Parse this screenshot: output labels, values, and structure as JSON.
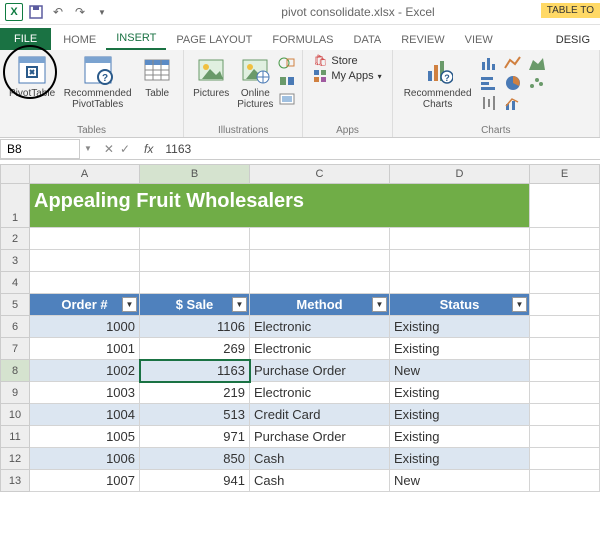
{
  "title": "pivot consolidate.xlsx - Excel",
  "table_tools": "TABLE TO",
  "tabs": {
    "file": "FILE",
    "home": "HOME",
    "insert": "INSERT",
    "pagelayout": "PAGE LAYOUT",
    "formulas": "FORMULAS",
    "data": "DATA",
    "review": "REVIEW",
    "view": "VIEW",
    "design": "DESIG"
  },
  "ribbon": {
    "tables": {
      "pivottable": "PivotTable",
      "recommended": "Recommended\nPivotTables",
      "table": "Table",
      "label": "Tables"
    },
    "illustrations": {
      "pictures": "Pictures",
      "online": "Online\nPictures",
      "label": "Illustrations"
    },
    "apps": {
      "store": "Store",
      "myapps": "My Apps",
      "label": "Apps"
    },
    "charts": {
      "recommended": "Recommended\nCharts",
      "label": "Charts"
    }
  },
  "namebox": "B8",
  "formula": "1163",
  "columns": [
    "A",
    "B",
    "C",
    "D",
    "E"
  ],
  "rows": [
    "1",
    "2",
    "3",
    "4",
    "5",
    "6",
    "7",
    "8",
    "9",
    "10",
    "11",
    "12",
    "13"
  ],
  "banner": "Appealing Fruit Wholesalers",
  "headers": {
    "order": "Order #",
    "sale": "$ Sale",
    "method": "Method",
    "status": "Status"
  },
  "data": [
    {
      "order": "1000",
      "sale": "1106",
      "method": "Electronic",
      "status": "Existing"
    },
    {
      "order": "1001",
      "sale": "269",
      "method": "Electronic",
      "status": "Existing"
    },
    {
      "order": "1002",
      "sale": "1163",
      "method": "Purchase Order",
      "status": "New"
    },
    {
      "order": "1003",
      "sale": "219",
      "method": "Electronic",
      "status": "Existing"
    },
    {
      "order": "1004",
      "sale": "513",
      "method": "Credit Card",
      "status": "Existing"
    },
    {
      "order": "1005",
      "sale": "971",
      "method": "Purchase Order",
      "status": "Existing"
    },
    {
      "order": "1006",
      "sale": "850",
      "method": "Cash",
      "status": "Existing"
    },
    {
      "order": "1007",
      "sale": "941",
      "method": "Cash",
      "status": "New"
    }
  ]
}
